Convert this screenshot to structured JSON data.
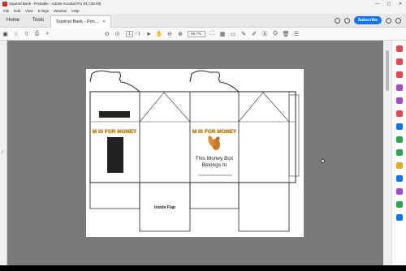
{
  "window": {
    "title": "Squirrel Bank - Printable - Adobe Acrobat Pro DC (32-bit)",
    "minimize": "—",
    "maximize": "▢",
    "close": "✕"
  },
  "menu": [
    "File",
    "Edit",
    "View",
    "E-Sign",
    "Window",
    "Help"
  ],
  "tabs": {
    "home": "Home",
    "tools": "Tools",
    "document": "Squirrel Bank - Prin...",
    "close": "×"
  },
  "header": {
    "subscribe": "Subscribe"
  },
  "toolbar": {
    "page_current": "1",
    "page_total": "/ 1",
    "zoom": "66.7%"
  },
  "document": {
    "banner_left": "M IS FOR MONEY",
    "banner_right": "M IS FOR MONEY",
    "money_box_line1": "This Money Box",
    "money_box_line2": "Belongs to",
    "inside_flap": "Inside Flap"
  },
  "colors": {
    "accent": "#1473e6",
    "banner": "#d9a21b",
    "squirrel": "#c9772a"
  }
}
